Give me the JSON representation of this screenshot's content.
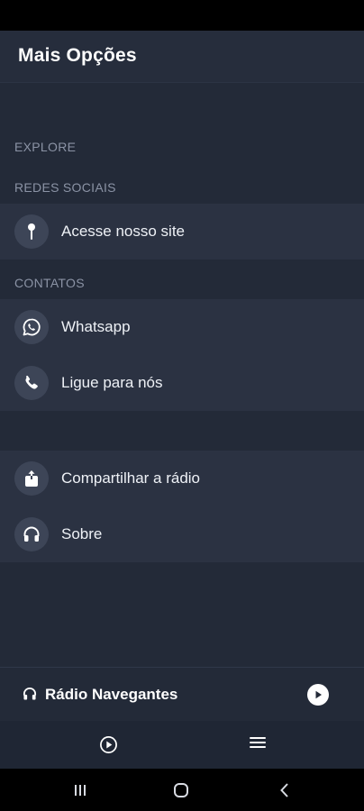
{
  "header": {
    "title": "Mais Opções"
  },
  "sections": {
    "explore": "EXPLORE",
    "social": "REDES SOCIAIS",
    "contacts": "CONTATOS"
  },
  "items": {
    "site": {
      "label": "Acesse nosso site",
      "icon": "pin-icon"
    },
    "whatsapp": {
      "label": "Whatsapp",
      "icon": "whatsapp-icon"
    },
    "call": {
      "label": "Ligue para nós",
      "icon": "phone-icon"
    },
    "share": {
      "label": "Compartilhar a rádio",
      "icon": "share-icon"
    },
    "about": {
      "label": "Sobre",
      "icon": "headphones-icon"
    }
  },
  "player": {
    "station": "Rádio Navegantes"
  },
  "colors": {
    "background": "#232a38",
    "row": "#2b3242",
    "icon_circle": "#3d4557",
    "section_label": "#8b93a5"
  }
}
